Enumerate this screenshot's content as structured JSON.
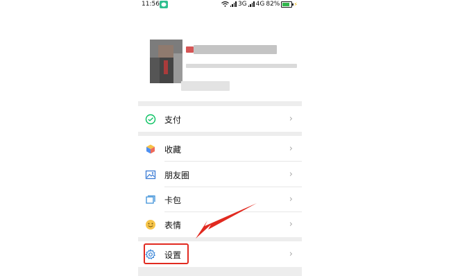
{
  "status_bar": {
    "time": "11:56",
    "signal_1": "3G",
    "signal_2": "4G",
    "battery": "82%"
  },
  "menu": {
    "pay": "支付",
    "favorites": "收藏",
    "moments": "朋友圈",
    "cards": "卡包",
    "stickers": "表情",
    "settings": "设置"
  },
  "colors": {
    "highlight": "#e12a20",
    "accent_green": "#07c160"
  },
  "icons": {
    "pay": "wechat-pay-icon",
    "favorites": "cube-icon",
    "moments": "image-icon",
    "cards": "wallet-icon",
    "stickers": "smiley-icon",
    "settings": "gear-icon",
    "chevron": "chevron-right-icon"
  }
}
